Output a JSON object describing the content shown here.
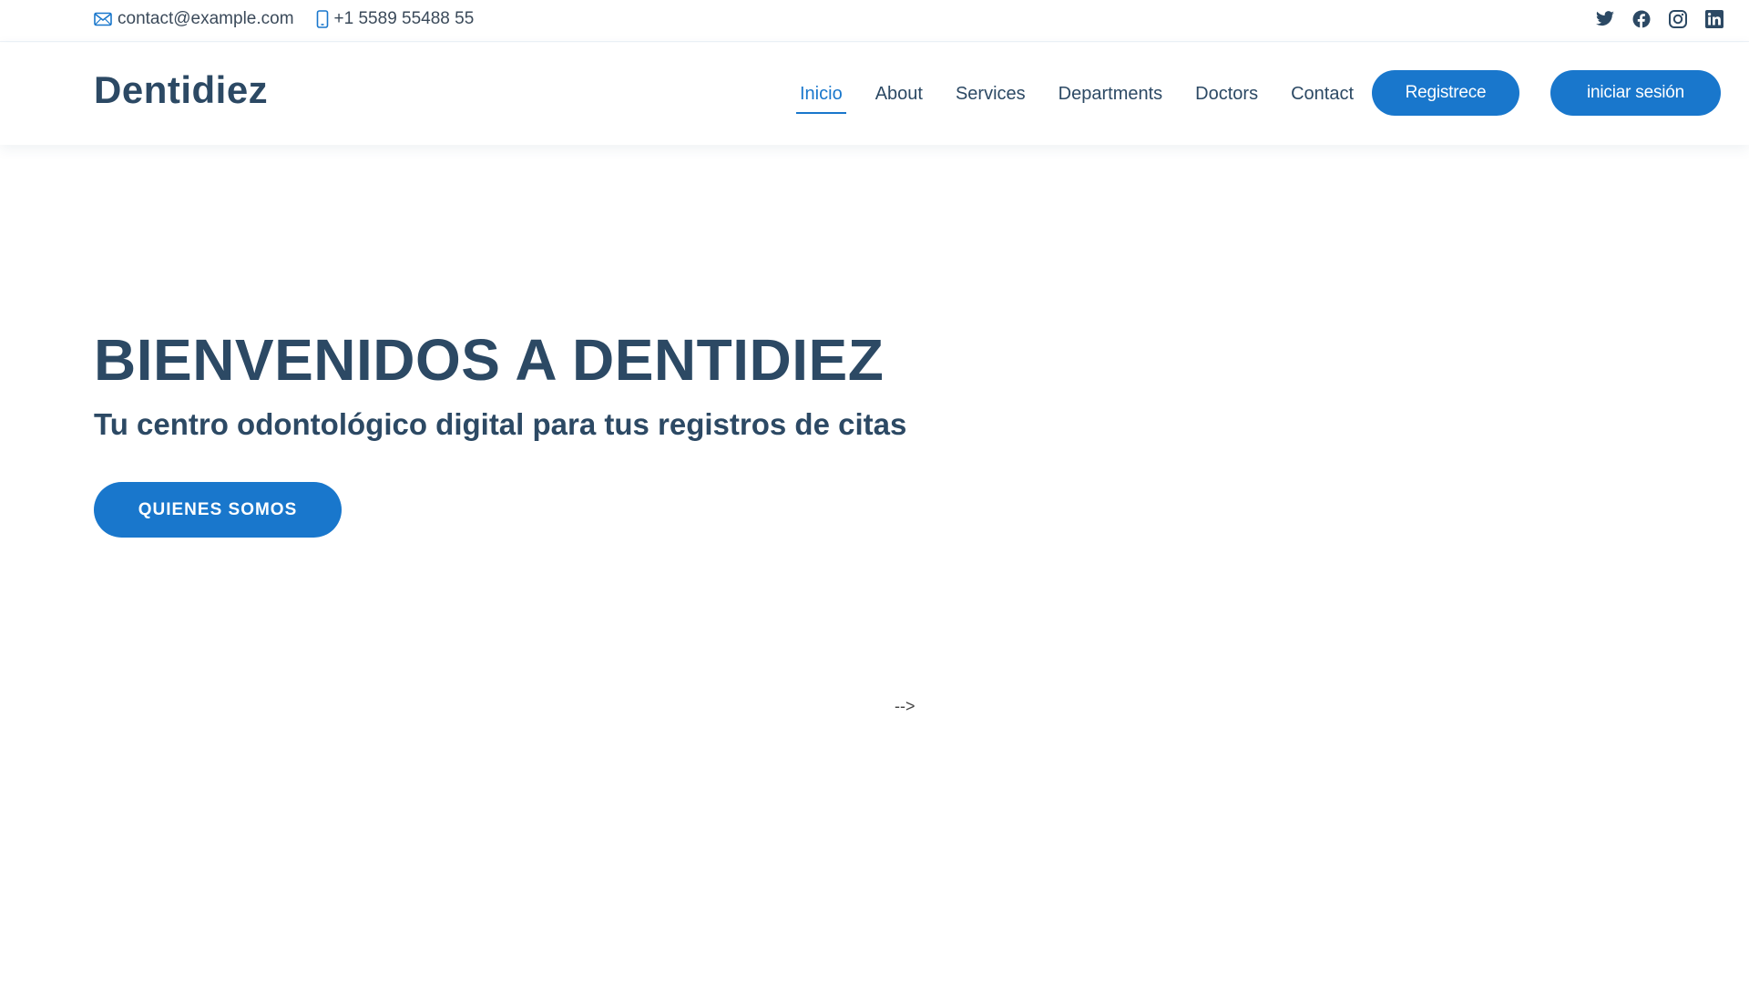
{
  "topbar": {
    "email": "contact@example.com",
    "phone": "+1 5589 55488 55",
    "social": [
      "twitter-icon",
      "facebook-icon",
      "instagram-icon",
      "linkedin-icon"
    ]
  },
  "header": {
    "logo": "Dentidiez",
    "nav": [
      {
        "label": "Inicio",
        "active": true
      },
      {
        "label": "About",
        "active": false
      },
      {
        "label": "Services",
        "active": false
      },
      {
        "label": "Departments",
        "active": false
      },
      {
        "label": "Doctors",
        "active": false
      },
      {
        "label": "Contact",
        "active": false
      }
    ],
    "register_label": "Registrece",
    "login_label": "iniciar sesión"
  },
  "hero": {
    "title": "BIENVENIDOS A DENTIDIEZ",
    "subtitle": "Tu centro odontológico digital para tus registros de citas",
    "button_label": "QUIENES SOMOS"
  },
  "stray_text": "-->",
  "colors": {
    "accent": "#1977cc",
    "text_dark": "#2c4964"
  }
}
